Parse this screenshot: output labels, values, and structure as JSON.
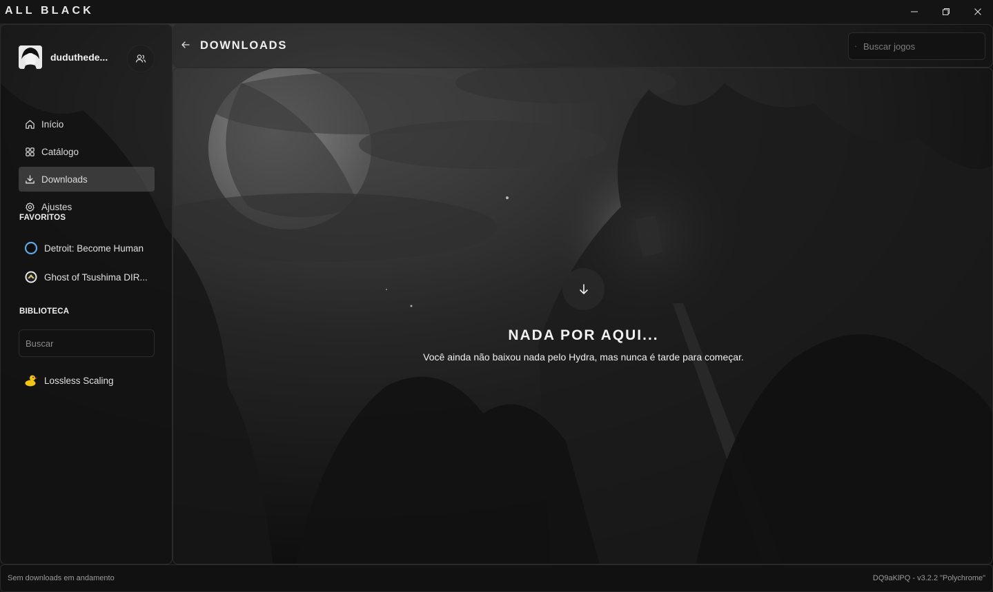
{
  "app": {
    "title": "ALL BLACK"
  },
  "window_controls": {
    "minimize_icon": "minimize-icon",
    "maximize_icon": "restore-icon",
    "close_icon": "close-icon"
  },
  "profile": {
    "username": "duduthede...",
    "friends_icon": "friends-icon"
  },
  "sidebar": {
    "items": [
      {
        "label": "Início",
        "icon": "home-icon"
      },
      {
        "label": "Catálogo",
        "icon": "grid-icon"
      },
      {
        "label": "Downloads",
        "icon": "download-icon",
        "active": true
      },
      {
        "label": "Ajustes",
        "icon": "gear-icon"
      }
    ],
    "favorites_title": "FAVORITOS",
    "favorites": [
      {
        "label": "Detroit: Become Human"
      },
      {
        "label": "Ghost of Tsushima DIR..."
      }
    ],
    "library_title": "BIBLIOTECA",
    "library_search_placeholder": "Buscar",
    "library": [
      {
        "label": "Lossless Scaling"
      }
    ]
  },
  "header": {
    "title": "DOWNLOADS",
    "search_placeholder": "Buscar jogos"
  },
  "main": {
    "empty_title": "NADA POR AQUI...",
    "empty_subtitle": "Você ainda não baixou nada pelo Hydra, mas nunca é tarde para começar."
  },
  "footer": {
    "status": "Sem downloads em andamento",
    "version": "DQ9aKlPQ - v3.2.2 \"Polychrome\""
  },
  "colors": {
    "background": "#0b0b0b",
    "active_item": "#5a5a5a",
    "border": "#2c2c2c",
    "text": "#e6e6e6"
  }
}
